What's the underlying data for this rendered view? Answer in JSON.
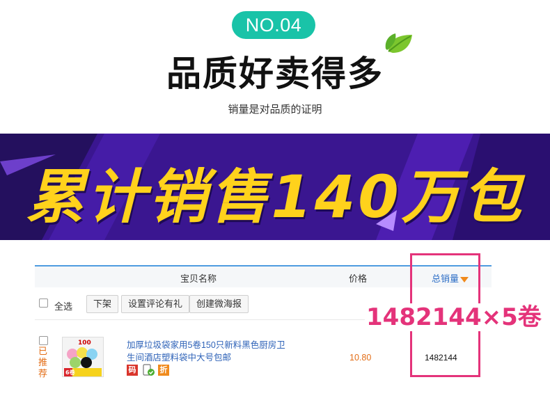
{
  "header": {
    "badge": "NO.04",
    "title": "品质好卖得多",
    "subtitle": "销量是对品质的证明",
    "leaf_icon": "leaf-icon"
  },
  "banner": {
    "text": "累计销售140万包"
  },
  "table": {
    "columns": {
      "name": "宝贝名称",
      "price": "价格",
      "sales": "总销量"
    },
    "toolbar": {
      "select_all": "全选",
      "buttons": [
        "下架",
        "设置评论有礼",
        "创建微海报"
      ]
    },
    "row": {
      "status": "已推荐",
      "thumbnail_badge": "100",
      "thumbnail_label": "6卷",
      "name": "加厚垃圾袋家用5卷150只新料黑色厨房卫生间酒店塑料袋中大号包邮",
      "tags": [
        "码",
        "折"
      ],
      "price": "10.80",
      "sales": "1482144"
    }
  },
  "annotation": {
    "text": "1482144×5卷"
  },
  "colors": {
    "accent": "#19c3a8",
    "banner_bg": "#3a1690",
    "banner_text": "#ffd21c",
    "link": "#2f63b8",
    "orange": "#e36d16",
    "highlight": "#e4337a"
  }
}
